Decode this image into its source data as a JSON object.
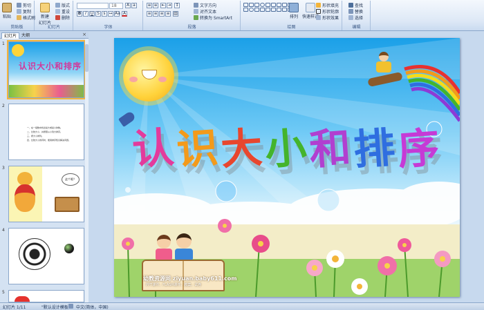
{
  "ribbon": {
    "clipboard": {
      "paste": "粘贴",
      "cut": "剪切",
      "copy": "复制",
      "format_painter": "格式刷",
      "label": "剪贴板"
    },
    "slides": {
      "new_slide": "新建",
      "new_slide_line2": "幻灯片",
      "layout": "版式",
      "reset": "重设",
      "delete": "删除",
      "label": "幻灯片"
    },
    "font": {
      "size": "18",
      "label": "字体"
    },
    "paragraph": {
      "text_direction": "文字方向",
      "align_text": "对齐文本",
      "smartart": "转换为 SmartArt",
      "label": "段落"
    },
    "drawing": {
      "arrange": "排列",
      "quick_styles": "快速样式",
      "shape_fill": "形状填充",
      "shape_outline": "形状轮廓",
      "shape_effects": "形状效果",
      "label": "绘图"
    },
    "editing": {
      "find": "查找",
      "replace": "替换",
      "select": "选择",
      "label": "编辑"
    }
  },
  "left_pane": {
    "tabs": [
      "幻灯片",
      "大纲"
    ],
    "close": "×",
    "slides": [
      {
        "number": "1",
        "title": "认识大小和排序"
      },
      {
        "number": "2",
        "lines": [
          "一、在一组数中找出最大或最小的数。",
          "二、比较大小，并按照从小到大排序。",
          "三、按大小排列。",
          "四、比较大小的同时，能用排序知识解决问题。"
        ]
      },
      {
        "number": "3",
        "bubble": "这个呢？"
      },
      {
        "number": "4"
      },
      {
        "number": "5"
      }
    ]
  },
  "slide": {
    "title": "认识大小和排序",
    "title_colors": [
      "#e33b9c",
      "#f39a1b",
      "#e8462e",
      "#44b42c",
      "#b13fd0",
      "#2f6ee0",
      "#c63ad6"
    ],
    "watermark_site": "幼教资源网 ziyuan.baby611.com",
    "watermark_sub": "PPT课件、FLASH课件、教案、试卷"
  },
  "status_bar": {
    "slide_of": "幻灯片 1/11",
    "theme": "\"默认设计模板\"",
    "language": "中文(简体，中国)"
  },
  "colors": {
    "ribbon_bg": "#dde8f6",
    "accent": "#f3b43a"
  }
}
